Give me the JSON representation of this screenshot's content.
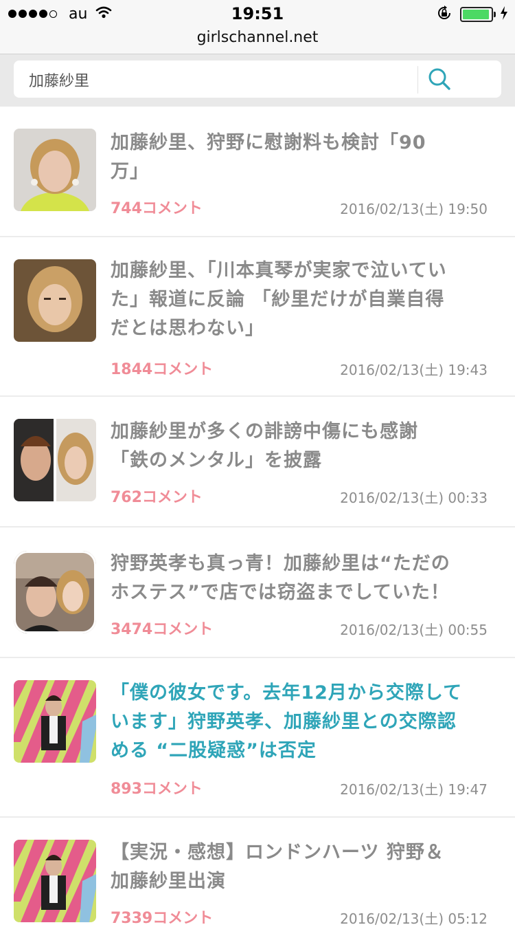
{
  "status_bar": {
    "carrier": "au",
    "time": "19:51"
  },
  "browser": {
    "url": "girlschannel.net"
  },
  "search": {
    "value": "加藤紗里",
    "icon": "search-icon"
  },
  "colors": {
    "accent": "#2fa5b8",
    "comment_count": "#f08c97",
    "title": "#8a8a8a",
    "date": "#8d8d8d"
  },
  "articles": [
    {
      "title_lines": [
        "加藤紗里、狩野に慰謝料も検討「90",
        "万」"
      ],
      "comments": "744コメント",
      "date": "2016/02/13(土) 19:50",
      "highlighted": false
    },
    {
      "title_lines": [
        "加藤紗里、「川本真琴が実家で泣いてい",
        "た」報道に反論 「紗里だけが自業自得",
        "だとは思わない」"
      ],
      "comments": "1844コメント",
      "date": "2016/02/13(土) 19:43",
      "highlighted": false
    },
    {
      "title_lines": [
        "加藤紗里が多くの誹謗中傷にも感謝",
        "「鉄のメンタル」を披露"
      ],
      "comments": "762コメント",
      "date": "2016/02/13(土) 00:33",
      "highlighted": false
    },
    {
      "title_lines": [
        "狩野英孝も真っ青！加藤紗里は“ただの",
        "ホステス”で店では窃盗までしていた！"
      ],
      "comments": "3474コメント",
      "date": "2016/02/13(土) 00:55",
      "highlighted": false
    },
    {
      "title_lines": [
        "「僕の彼女です。去年12月から交際して",
        "います」狩野英孝、加藤紗里との交際認",
        "める “二股疑惑”は否定"
      ],
      "comments": "893コメント",
      "date": "2016/02/13(土) 19:47",
      "highlighted": true
    },
    {
      "title_lines": [
        "【実況・感想】ロンドンハーツ 狩野＆",
        "加藤紗里出演"
      ],
      "comments": "7339コメント",
      "date": "2016/02/13(土) 05:12",
      "highlighted": false
    }
  ]
}
